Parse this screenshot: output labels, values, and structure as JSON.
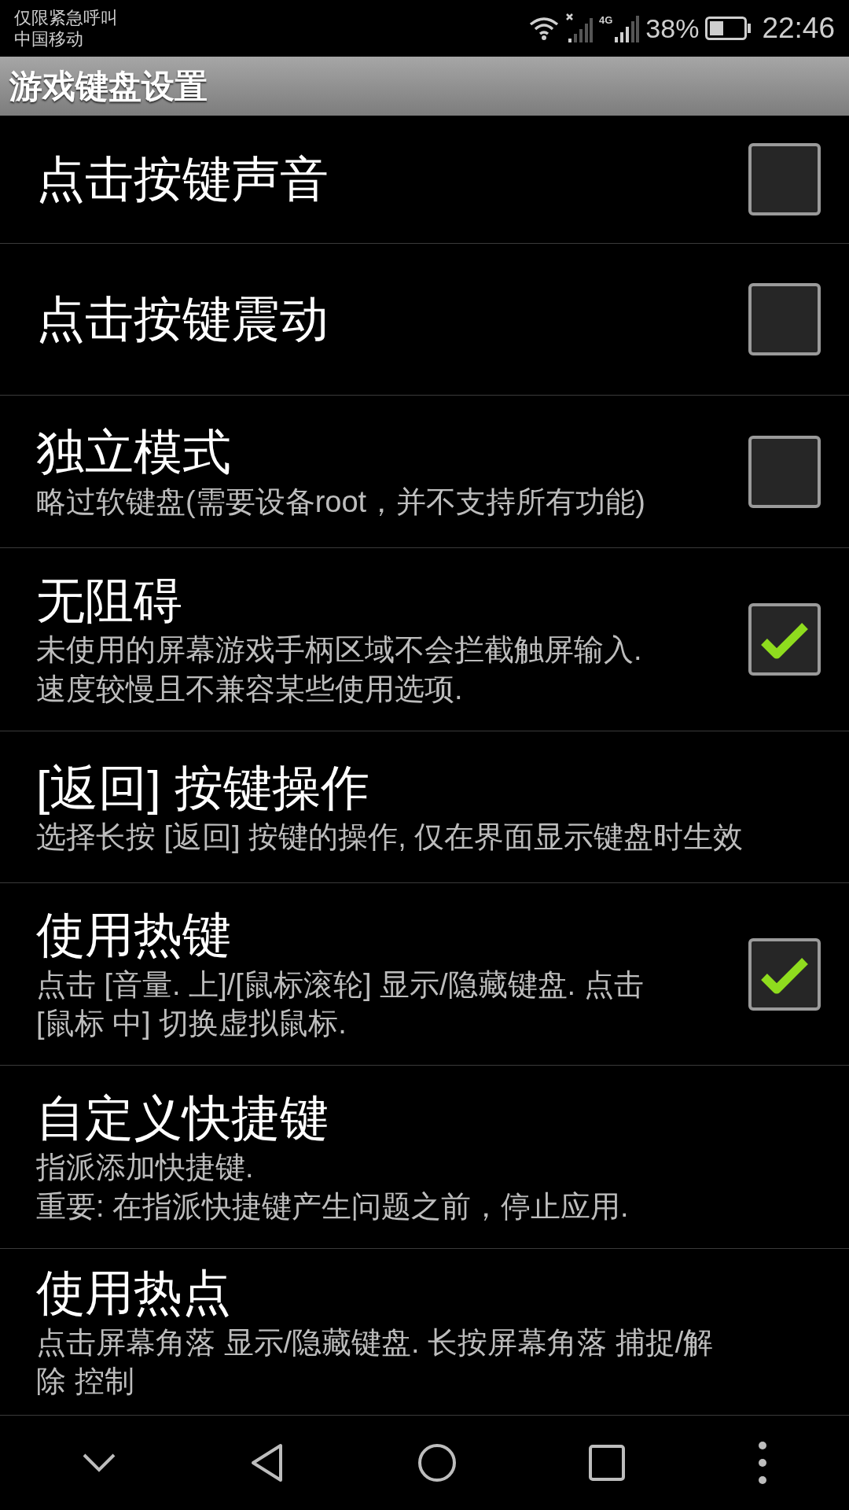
{
  "status_bar": {
    "notice": "仅限紧急呼叫",
    "carrier": "中国移动",
    "network_label": "4G",
    "battery": "38%",
    "time": "22:46"
  },
  "title_bar": {
    "title": "游戏键盘设置"
  },
  "settings": [
    {
      "kind": "checkbox",
      "title": "点击按键声音",
      "checked": false
    },
    {
      "kind": "checkbox",
      "title": "点击按键震动",
      "checked": false
    },
    {
      "kind": "checkbox",
      "title": "独立模式",
      "summary_lines": [
        "略过软键盘(需要设备root，并不支持所有功能)"
      ],
      "checked": false
    },
    {
      "kind": "checkbox",
      "title": "无阻碍",
      "summary_lines": [
        "未使用的屏幕游戏手柄区域不会拦截触屏输入.",
        "速度较慢且不兼容某些使用选项."
      ],
      "checked": true
    },
    {
      "kind": "link",
      "title": "[返回] 按键操作",
      "summary_lines": [
        "选择长按 [返回] 按键的操作, 仅在界面显示键盘时生效"
      ]
    },
    {
      "kind": "checkbox",
      "title": "使用热键",
      "summary_lines": [
        "点击 [音量. 上]/[鼠标滚轮] 显示/隐藏键盘. 点击",
        "[鼠标 中] 切换虚拟鼠标."
      ],
      "checked": true
    },
    {
      "kind": "link",
      "title": "自定义快捷键",
      "summary_lines": [
        "指派添加快捷键.",
        "重要: 在指派快捷键产生问题之前，停止应用."
      ]
    },
    {
      "kind": "link",
      "title": "使用热点",
      "summary_lines": [
        "点击屏幕角落 显示/隐藏键盘. 长按屏幕角落 捕捉/解",
        "除 控制"
      ]
    }
  ]
}
